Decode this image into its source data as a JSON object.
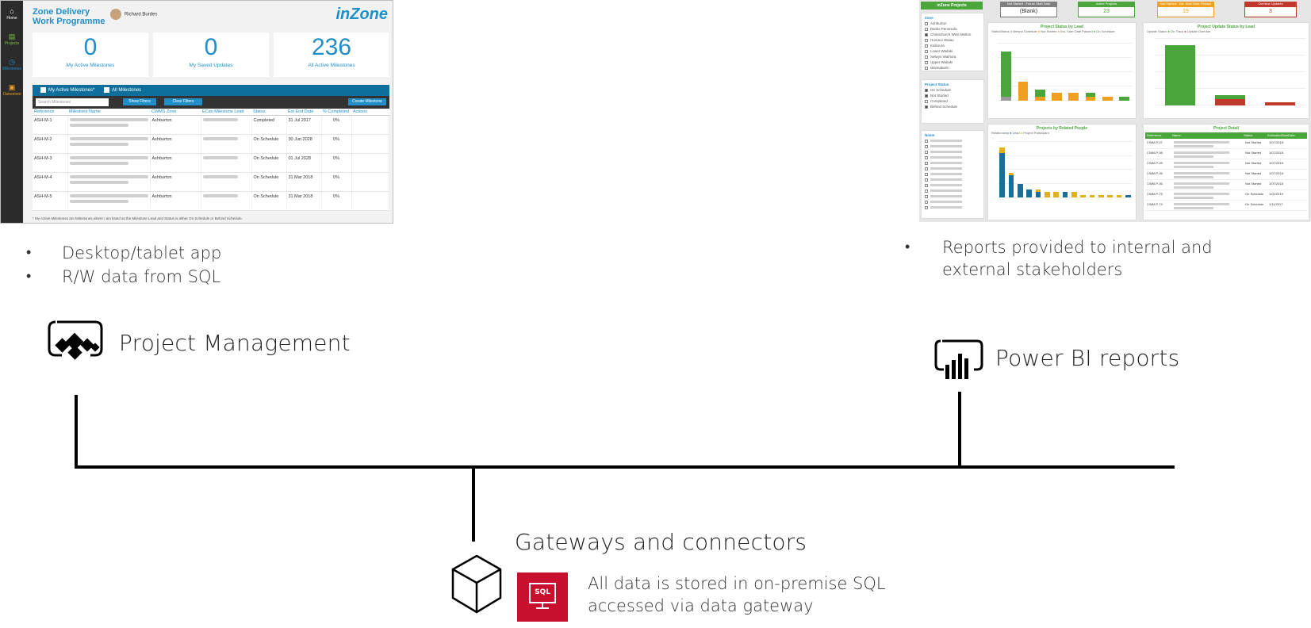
{
  "left_app": {
    "rail": [
      {
        "label": "Home",
        "color": "#ffffff"
      },
      {
        "label": "Projects",
        "color": "#7ec242"
      },
      {
        "label": "Milestones",
        "color": "#1f8ec9"
      },
      {
        "label": "Outcomes",
        "color": "#f0a020"
      }
    ],
    "title_line1": "Zone Delivery",
    "title_line2": "Work Programme",
    "user": "Richard Burdes",
    "logo": "inZone",
    "kpis": [
      {
        "value": "0",
        "label": "My Active Milestones"
      },
      {
        "value": "0",
        "label": "My Saved Updates"
      },
      {
        "value": "236",
        "label": "All Active Milestones"
      }
    ],
    "filter": {
      "my_active": "My Active Milestones*",
      "all_milestones": "All Milestones",
      "search_placeholder": "Search Milestones",
      "show_filters": "Show Filters",
      "clear_filters": "Clear Filters",
      "create": "Create Milestone"
    },
    "columns": [
      "Reference",
      "Milestone Name",
      "CWMS Zone",
      "ECan Milestone Lead",
      "Status",
      "Est End Date",
      "% Completed",
      "Actions"
    ],
    "rows": [
      {
        "ref": "ASH-M-1",
        "zone": "Ashburton",
        "status": "Completed",
        "date": "31 Jul 2017",
        "pct": "0%"
      },
      {
        "ref": "ASH-M-2",
        "zone": "Ashburton",
        "status": "On Schedule",
        "date": "30 Jun 2028",
        "pct": "0%"
      },
      {
        "ref": "ASH-M-3",
        "zone": "Ashburton",
        "status": "On Schedule",
        "date": "01 Jul 2028",
        "pct": "0%"
      },
      {
        "ref": "ASH-M-4",
        "zone": "Ashburton",
        "status": "On Schedule",
        "date": "31 Mar 2018",
        "pct": "0%"
      },
      {
        "ref": "ASH-M-5",
        "zone": "Ashburton",
        "status": "On Schedule",
        "date": "31 Mar 2018",
        "pct": "0%"
      }
    ],
    "footnote": "* My Active Milestones are Milestones where I am listed as the Milestone Lead and Status is either On Schedule or Behind Schedule."
  },
  "right_report": {
    "header": "inZone Projects",
    "cards": [
      {
        "title": "Not Started - Future Start Date",
        "value": "(Blank)",
        "color": "#7f7f7f"
      },
      {
        "title": "Active Projects",
        "value": "23",
        "color": "#4aa63b"
      },
      {
        "title": "Not Started - Est. Start Date Passed",
        "value": "19",
        "color": "#f0a020"
      },
      {
        "title": "Overdue Updates",
        "value": "3",
        "color": "#c0392b"
      }
    ],
    "zone_label": "Zone",
    "zones": [
      {
        "name": "Ashburton",
        "checked": false
      },
      {
        "name": "Banks Peninsula",
        "checked": false
      },
      {
        "name": "Christchurch West Melton",
        "checked": true
      },
      {
        "name": "Hurunui Waiau",
        "checked": false
      },
      {
        "name": "Kaikoura",
        "checked": false
      },
      {
        "name": "Lower Waitaki",
        "checked": false
      },
      {
        "name": "Selwyn Waihora",
        "checked": false
      },
      {
        "name": "Upper Waitaki",
        "checked": false
      },
      {
        "name": "Waimakariri",
        "checked": false
      }
    ],
    "status_label": "Project Status",
    "statuses": [
      {
        "name": "On Schedule",
        "checked": true
      },
      {
        "name": "Not Started",
        "checked": true
      },
      {
        "name": "Completed",
        "checked": false
      },
      {
        "name": "Behind Schedule",
        "checked": true
      }
    ],
    "name_label": "Name",
    "chart1_title": "Project Status by Lead",
    "chart1_legend_label": "StatusStatus",
    "chart1_legend": [
      "Behind Schedule",
      "Not Started",
      "Est. Start Date Passed",
      "On Schedule"
    ],
    "chart2_title": "Project Update Status by Lead",
    "chart2_legend_label": "Update Status",
    "chart2_legend": [
      "On Track",
      "Update Overdue"
    ],
    "chart3_title": "Projects by Related People",
    "chart3_legend_label": "Relationship",
    "chart3_legend": [
      "Lead",
      "Project Participant"
    ],
    "table_title": "Project Detail",
    "table_cols": [
      "Reference",
      "Name",
      "Status",
      "EstimatedStartDate"
    ],
    "table_rows": [
      {
        "ref": "CWM-P-07",
        "status": "Not Started",
        "date": "1/07/2018"
      },
      {
        "ref": "CWM-P-08",
        "status": "Not Started",
        "date": "1/07/2018"
      },
      {
        "ref": "CWM-P-09",
        "status": "Not Started",
        "date": "1/07/2018"
      },
      {
        "ref": "CWM-P-05",
        "status": "Not Started",
        "date": "1/07/2018"
      },
      {
        "ref": "CWM-P-06",
        "status": "Not Started",
        "date": "1/07/2018"
      },
      {
        "ref": "CWM-P-73",
        "status": "On Schedule",
        "date": "1/02/2019"
      },
      {
        "ref": "CWM-P-74",
        "status": "On Schedule",
        "date": "1/11/2017"
      }
    ]
  },
  "diagram": {
    "left_bullets": [
      "Desktop/tablet app",
      "R/W data from SQL"
    ],
    "right_bullets": [
      "Reports provided to internal and external stakeholders"
    ],
    "pm_label": "Project Management",
    "pbi_label": "Power BI reports",
    "gw_label": "Gateways and connectors",
    "sql_badge": "SQL",
    "sql_desc_line1": "All data is stored in on-premise SQL",
    "sql_desc_line2": "accessed via data gateway"
  }
}
